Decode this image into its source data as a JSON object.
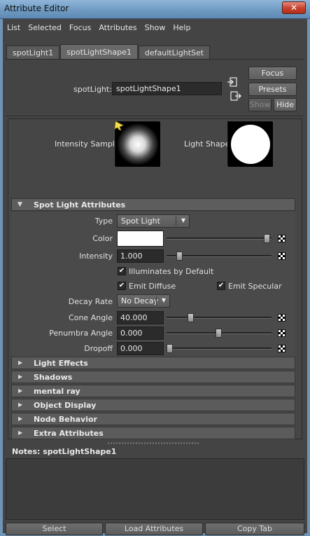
{
  "window": {
    "title": "Attribute Editor",
    "close": "✕"
  },
  "menu": [
    "List",
    "Selected",
    "Focus",
    "Attributes",
    "Show",
    "Help"
  ],
  "tabs": [
    "spotLight1",
    "spotLightShape1",
    "defaultLightSet"
  ],
  "active_tab": 1,
  "node": {
    "label": "spotLight:",
    "value": "spotLightShape1"
  },
  "buttons": {
    "focus": "Focus",
    "presets": "Presets",
    "show": "Show",
    "hide": "Hide"
  },
  "samples": {
    "intensity_label": "Intensity Sample",
    "shape_label": "Light Shape"
  },
  "spot_section": {
    "title": "Spot Light Attributes",
    "type_label": "Type",
    "type_value": "Spot Light",
    "color_label": "Color",
    "color_value": "#ffffff",
    "intensity_label": "Intensity",
    "intensity_value": "1.000",
    "illuminates_label": "Illuminates by Default",
    "emit_diffuse_label": "Emit Diffuse",
    "emit_specular_label": "Emit Specular",
    "decay_label": "Decay Rate",
    "decay_value": "No Decay",
    "cone_label": "Cone Angle",
    "cone_value": "40.000",
    "penumbra_label": "Penumbra Angle",
    "penumbra_value": "0.000",
    "dropoff_label": "Dropoff",
    "dropoff_value": "0.000",
    "check": "✔"
  },
  "collapsed_sections": [
    "Light Effects",
    "Shadows",
    "mental ray",
    "Object Display",
    "Node Behavior",
    "Extra Attributes"
  ],
  "notes": {
    "label": "Notes:  spotLightShape1"
  },
  "bottom_buttons": [
    "Select",
    "Load Attributes",
    "Copy Tab"
  ]
}
